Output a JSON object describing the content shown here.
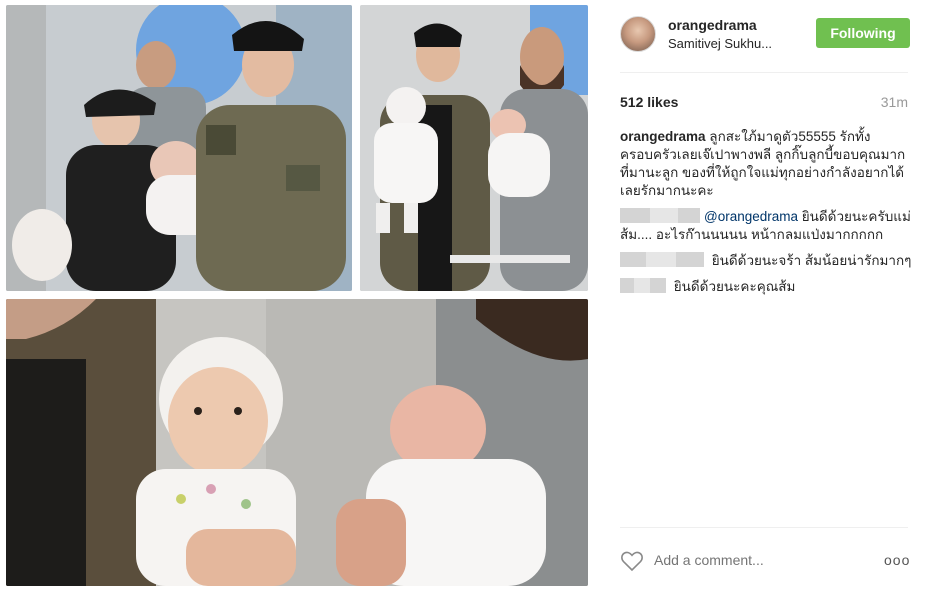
{
  "post": {
    "username": "orangedrama",
    "location": "Samitivej Sukhu...",
    "follow_label": "Following",
    "likes": "512 likes",
    "time": "31m"
  },
  "comments": [
    {
      "user": "orangedrama",
      "text": "ลูกสะใภ้มาดูตัว55555 รักทั้งครอบครัวเลยเจ๊เปาพางพลี ลูกกิ๊บลูกบี้ขอบคุณมากที่มานะลูก ของที่ให้ถูกใจแม่ทุกอย่างกำลังอยากได้เลยรักมากนะคะ"
    },
    {
      "mention": "@orangedrama",
      "text": " ยินดีด้วยนะครับแม่ส้ม.... อะไรก๊านนนนน หน้ากลมแป่งมากกกกก"
    },
    {
      "text": "ยินดีด้วยนะจร้า ส้มน้อยน่ารักมากๆ"
    },
    {
      "text": "ยินดีด้วยนะคะคุณส้ม"
    }
  ],
  "footer": {
    "add_comment_placeholder": "Add a comment...",
    "more_label": "ooo",
    "heart_icon": "heart-outline-icon"
  },
  "colors": {
    "follow_button": "#70c050",
    "mention": "#003569",
    "muted": "#999999"
  }
}
